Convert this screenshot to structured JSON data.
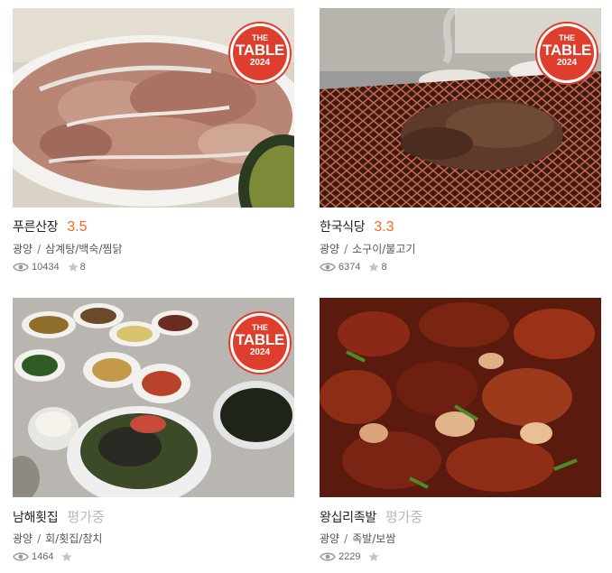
{
  "badge": {
    "line1": "THE",
    "line2": "TABLE",
    "line3": "2024"
  },
  "separator": "/",
  "restaurants": [
    {
      "name": "푸른산장",
      "rating": "3.5",
      "region": "광양",
      "categories": "삼계탕/백숙/찜닭",
      "views": "10434",
      "stars": "8",
      "has_badge": true,
      "photo_icon": "grilled-chicken-plate"
    },
    {
      "name": "한국식당",
      "rating": "3.3",
      "region": "광양",
      "categories": "소구이/불고기",
      "views": "6374",
      "stars": "8",
      "has_badge": true,
      "photo_icon": "bulgogi-grill"
    },
    {
      "name": "남해횟집",
      "rating": "평가중",
      "region": "광양",
      "categories": "회/횟집/참치",
      "views": "1464",
      "stars": "",
      "has_badge": true,
      "photo_icon": "bibimbap-table"
    },
    {
      "name": "왕십리족발",
      "rating": "평가중",
      "region": "광양",
      "categories": "족발/보쌈",
      "views": "2229",
      "stars": "",
      "has_badge": false,
      "photo_icon": "spicy-pork-dish"
    }
  ],
  "colors": {
    "rating": "#f26a21",
    "pending": "#b8b8b8",
    "badge": "#e03e2d"
  }
}
